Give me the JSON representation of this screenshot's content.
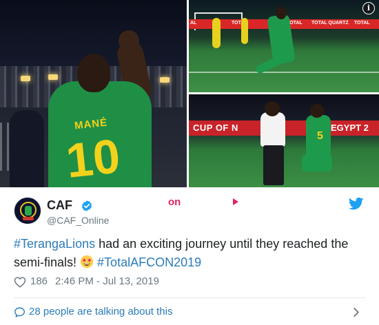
{
  "media": {
    "info_glyph": "i",
    "photo_left": {
      "jersey_name": "MANÉ",
      "jersey_number": "10"
    },
    "photo_top_right": {
      "ad_texts": [
        "AL",
        "TOTAL",
        "TOTAL",
        "TOTAL QUARTZ",
        "TOTAL"
      ]
    },
    "photo_bottom_right": {
      "banner_left": "CUP OF N",
      "banner_right": "EGYPT 2",
      "jersey_number": "5"
    }
  },
  "tweet": {
    "author": {
      "display_name": "CAF",
      "screen_name": "@CAF_Online",
      "verified": true
    },
    "on_label": "on",
    "text": {
      "hashtag1": "#TerangaLions",
      "body": " had an exciting journey until they reached the semi-finals! ",
      "hashtag2": "#TotalAFCON2019"
    },
    "likes": "186",
    "timestamp": "2:46 PM - Jul 13, 2019",
    "talking": "28 people are talking about this"
  },
  "colors": {
    "link": "#2b7bb9",
    "text": "#1c2022",
    "muted": "#697882",
    "divider": "#e1e8ed",
    "twitter_blue": "#1da1f2",
    "accent_red": "#e0245e"
  },
  "icons": [
    "info-icon",
    "verified-icon",
    "play-icon",
    "twitter-bird-icon",
    "star-struck-emoji",
    "heart-icon",
    "speech-bubble-icon",
    "chevron-right-icon"
  ]
}
